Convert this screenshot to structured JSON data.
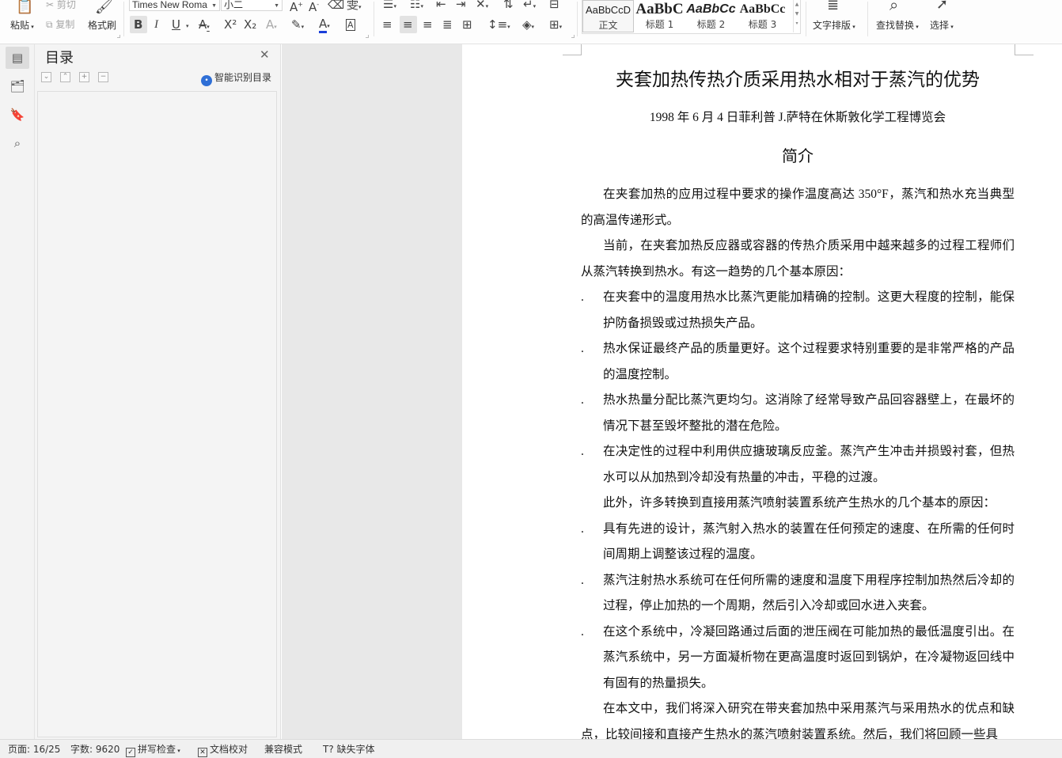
{
  "ribbon": {
    "paste": "粘贴",
    "cut": "剪切",
    "copy": "复制",
    "format_painter": "格式刷",
    "font_name": "Times New Roma",
    "font_size": "小二",
    "bold": "B",
    "italic": "I",
    "underline": "U",
    "superscript": "X²",
    "subscript": "X₂",
    "styles": [
      {
        "sample": "AaBbCcD",
        "label": "正文"
      },
      {
        "sample": "AaBbC",
        "label": "标题 1"
      },
      {
        "sample": "AaBbCc",
        "label": "标题 2"
      },
      {
        "sample": "AaBbCc",
        "label": "标题 3"
      }
    ],
    "text_layout": "文字排版",
    "find_replace": "查找替换",
    "select": "选择"
  },
  "sidebar_icons": [
    "toc-icon",
    "folder-icon",
    "bookmark-icon",
    "search-icon"
  ],
  "toc": {
    "title": "目录",
    "smart_detect": "智能识别目录"
  },
  "document": {
    "title": "夹套加热传热介质采用热水相对于蒸汽的优势",
    "subtitle": "1998 年 6 月 4 日菲利普 J.萨特在休斯敦化学工程博览会",
    "heading": "简介",
    "bullet_char": ".",
    "blocks": [
      {
        "type": "para",
        "text": "在夹套加热的应用过程中要求的操作温度高达 350°F，蒸汽和热水充当典型的高温传递形式。"
      },
      {
        "type": "para",
        "text": "当前，在夹套加热反应器或容器的传热介质采用中越来越多的过程工程师们从蒸汽转换到热水。有这一趋势的几个基本原因："
      },
      {
        "type": "bullet",
        "text": "在夹套中的温度用热水比蒸汽更能加精确的控制。这更大程度的控制，能保护防备损毁或过热损失产品。"
      },
      {
        "type": "bullet",
        "text": "热水保证最终产品的质量更好。这个过程要求特别重要的是非常严格的产品的温度控制。"
      },
      {
        "type": "bullet",
        "text": "热水热量分配比蒸汽更均匀。这消除了经常导致产品回容器壁上，在最坏的情况下甚至毁坏整批的潜在危险。"
      },
      {
        "type": "bullet",
        "text": "在决定性的过程中利用供应搪玻璃反应釜。蒸汽产生冲击并损毁衬套，但热水可以从加热到冷却没有热量的冲击，平稳的过渡。"
      },
      {
        "type": "para",
        "text": "此外，许多转换到直接用蒸汽喷射装置系统产生热水的几个基本的原因："
      },
      {
        "type": "bullet",
        "text": "具有先进的设计，蒸汽射入热水的装置在任何预定的速度、在所需的任何时间周期上调整该过程的温度。"
      },
      {
        "type": "bullet",
        "text": "蒸汽注射热水系统可在任何所需的速度和温度下用程序控制加热然后冷却的过程，停止加热的一个周期，然后引入冷却或回水进入夹套。"
      },
      {
        "type": "bullet",
        "text": "在这个系统中，冷凝回路通过后面的泄压阀在可能加热的最低温度引出。在蒸汽系统中，另一方面凝析物在更高温度时返回到锅炉，在冷凝物返回线中有固有的热量损失。"
      },
      {
        "type": "para",
        "text": "在本文中，我们将深入研究在带夹套加热中采用蒸汽与采用热水的优点和缺点，比较间接和直接产生热水的蒸汽喷射装置系统。然后，我们将回顾一些具"
      }
    ]
  },
  "statusbar": {
    "page": "页面: 16/25",
    "word_count": "字数: 9620",
    "spell_check": "拼写检查",
    "doc_proof": "文档校对",
    "compat_mode": "兼容模式",
    "missing_fonts": "缺失字体"
  }
}
